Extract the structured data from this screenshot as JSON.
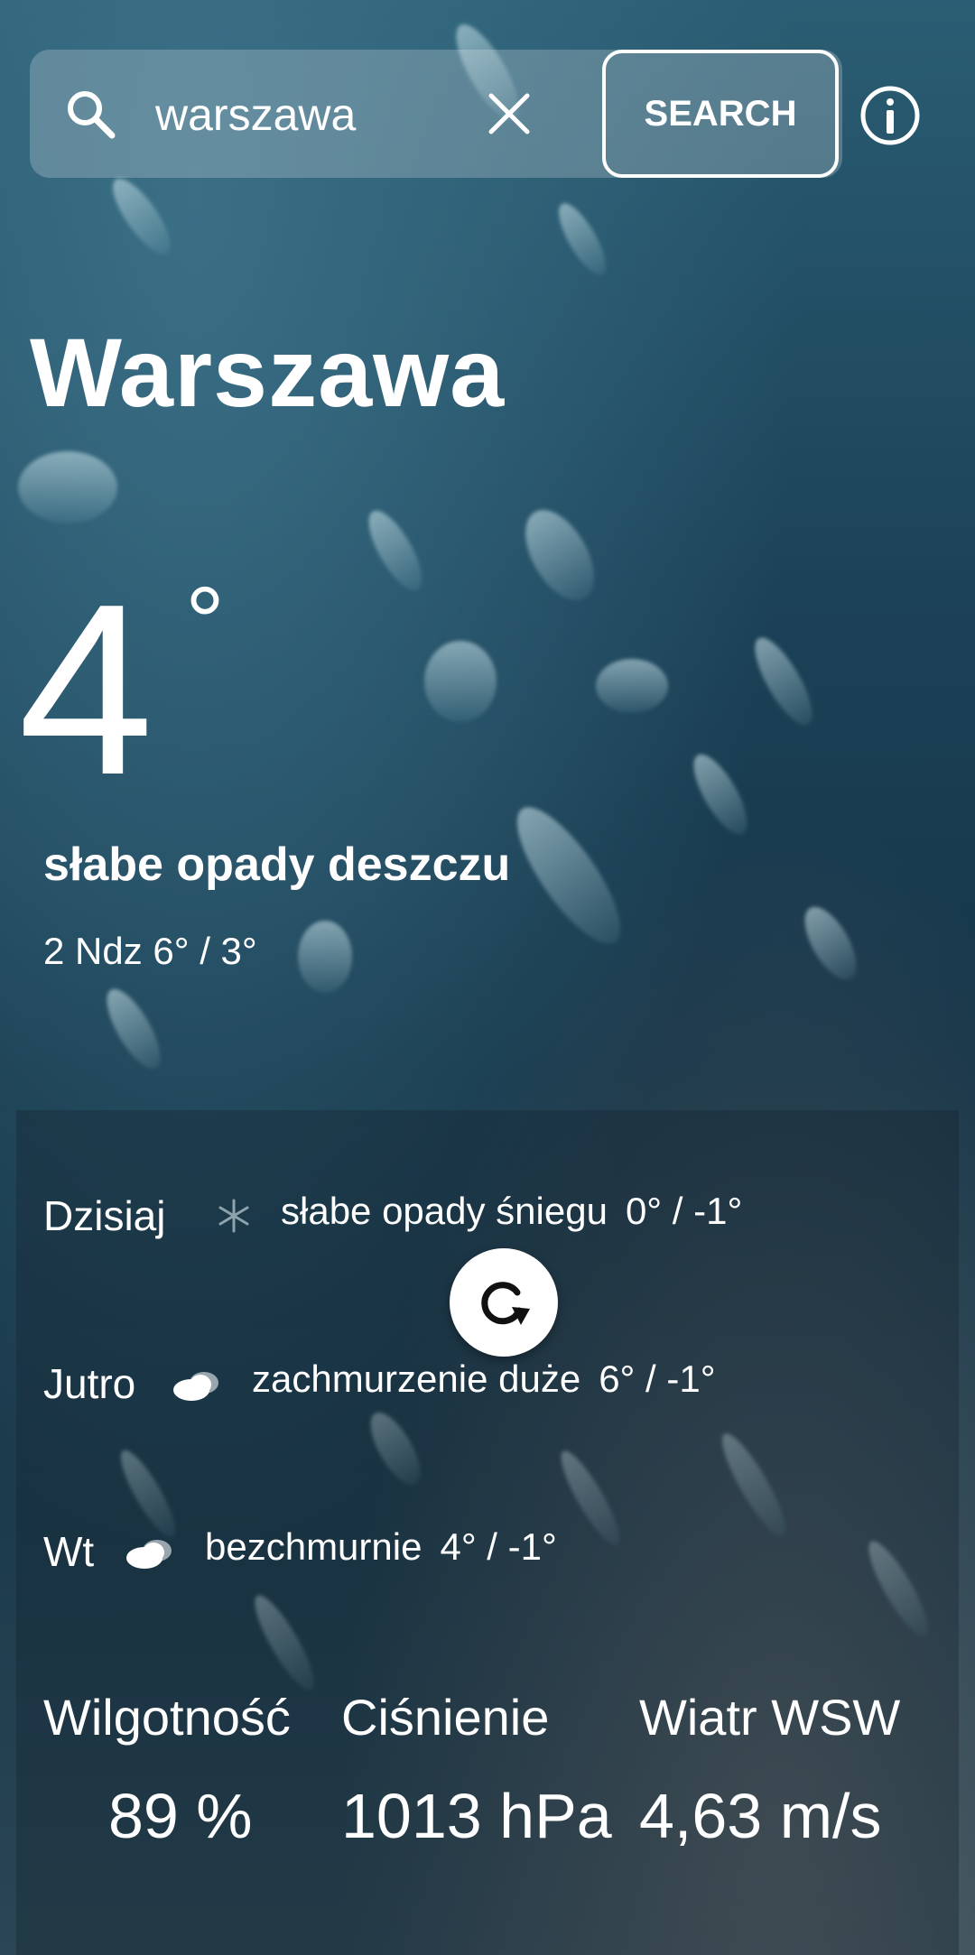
{
  "search": {
    "value": "warszawa",
    "button_label": "SEARCH"
  },
  "current": {
    "city": "Warszawa",
    "temperature": "4",
    "unit": "°",
    "condition": "słabe opady deszczu",
    "date_range": "2 Ndz 6° / 3°"
  },
  "forecast": [
    {
      "day": "Dzisiaj",
      "icon": "snowflake-icon",
      "description": "słabe opady śniegu",
      "temps": "0° / -1°"
    },
    {
      "day": "Jutro",
      "icon": "cloud-icon",
      "description": "zachmurzenie duże",
      "temps": "6° / -1°"
    },
    {
      "day": "Wt",
      "icon": "cloud-icon",
      "description": "bezchmurnie",
      "temps": "4° / -1°"
    }
  ],
  "stats": [
    {
      "label": "Wilgotność",
      "value": "89 %"
    },
    {
      "label": "Ciśnienie",
      "value": "1013 hPa"
    },
    {
      "label": "Wiatr WSW",
      "value": "4,63 m/s"
    }
  ],
  "colors": {
    "text": "#ffffff",
    "background": "#1c4258",
    "panel": "#14232d"
  }
}
